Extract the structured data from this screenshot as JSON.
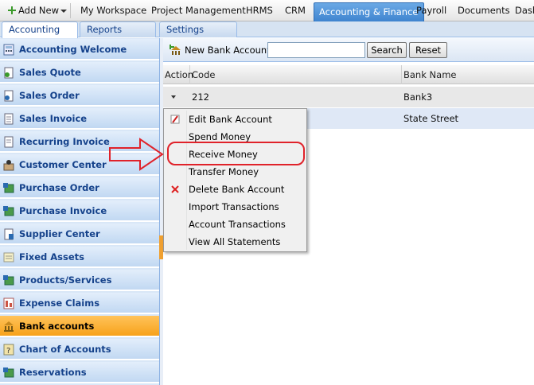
{
  "topnav": {
    "add_new": "Add New",
    "items": [
      "My Workspace",
      "Project Management",
      "HRMS",
      "CRM",
      "Accounting & Finance",
      "Payroll",
      "Documents",
      "Dash"
    ]
  },
  "sidebar": {
    "tabs": [
      "Accounting",
      "Reports",
      "Settings"
    ],
    "items": [
      {
        "label": "Accounting Welcome",
        "icon": "calculator-icon"
      },
      {
        "label": "Sales Quote",
        "icon": "quote-icon"
      },
      {
        "label": "Sales Order",
        "icon": "order-icon"
      },
      {
        "label": "Sales Invoice",
        "icon": "invoice-icon"
      },
      {
        "label": "Recurring Invoice",
        "icon": "recurring-icon"
      },
      {
        "label": "Customer Center",
        "icon": "customer-icon"
      },
      {
        "label": "Purchase Order",
        "icon": "purchase-order-icon"
      },
      {
        "label": "Purchase Invoice",
        "icon": "purchase-invoice-icon"
      },
      {
        "label": "Supplier Center",
        "icon": "supplier-icon"
      },
      {
        "label": "Fixed Assets",
        "icon": "fixed-assets-icon"
      },
      {
        "label": "Products/Services",
        "icon": "products-icon"
      },
      {
        "label": "Expense Claims",
        "icon": "expense-icon"
      },
      {
        "label": "Bank accounts",
        "icon": "bank-icon"
      },
      {
        "label": "Chart of Accounts",
        "icon": "chart-accounts-icon"
      },
      {
        "label": "Reservations",
        "icon": "reservations-icon"
      }
    ],
    "active_index": 12
  },
  "toolbar": {
    "new_label": "New Bank Account",
    "search_value": "",
    "search_label": "Search",
    "reset_label": "Reset"
  },
  "grid": {
    "columns": [
      "Action",
      "Code",
      "Bank Name"
    ],
    "rows": [
      {
        "code": "212",
        "bank": "Bank3"
      },
      {
        "code": "",
        "bank": "State Street"
      }
    ]
  },
  "menu": {
    "items": [
      {
        "label": "Edit Bank Account",
        "icon": "edit-icon"
      },
      {
        "label": "Spend Money",
        "icon": ""
      },
      {
        "label": "Receive Money",
        "icon": ""
      },
      {
        "label": "Transfer Money",
        "icon": ""
      },
      {
        "label": "Delete Bank Account",
        "icon": "delete-icon"
      },
      {
        "label": "Import Transactions",
        "icon": ""
      },
      {
        "label": "Account Transactions",
        "icon": ""
      },
      {
        "label": "View All Statements",
        "icon": ""
      }
    ],
    "highlighted": "Receive Money"
  },
  "colors": {
    "accent": "#3f84cf",
    "sidebar_active": "#f7a21b",
    "annotation_red": "#e0222a"
  }
}
